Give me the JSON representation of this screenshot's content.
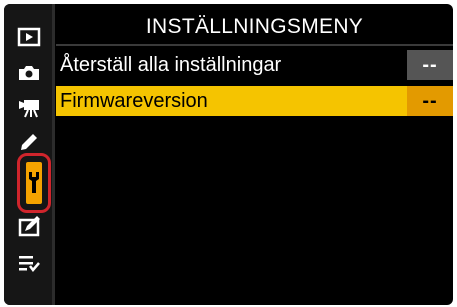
{
  "menu": {
    "title": "INSTÄLLNINGSMENY",
    "items": [
      {
        "label": "Återställ alla inställningar",
        "value": "--",
        "selected": false
      },
      {
        "label": "Firmwareversion",
        "value": "--",
        "selected": true
      }
    ]
  },
  "sidebar": {
    "icons": [
      "playback-icon",
      "camera-icon",
      "movie-icon",
      "pencil-icon",
      "wrench-icon",
      "retouch-icon",
      "my-menu-icon"
    ],
    "selected": "wrench-icon"
  },
  "colors": {
    "highlight": "#f5c400",
    "value_highlight": "#e39a00",
    "selection_outline": "#d0252c",
    "tab_selected": "#f5a300"
  }
}
